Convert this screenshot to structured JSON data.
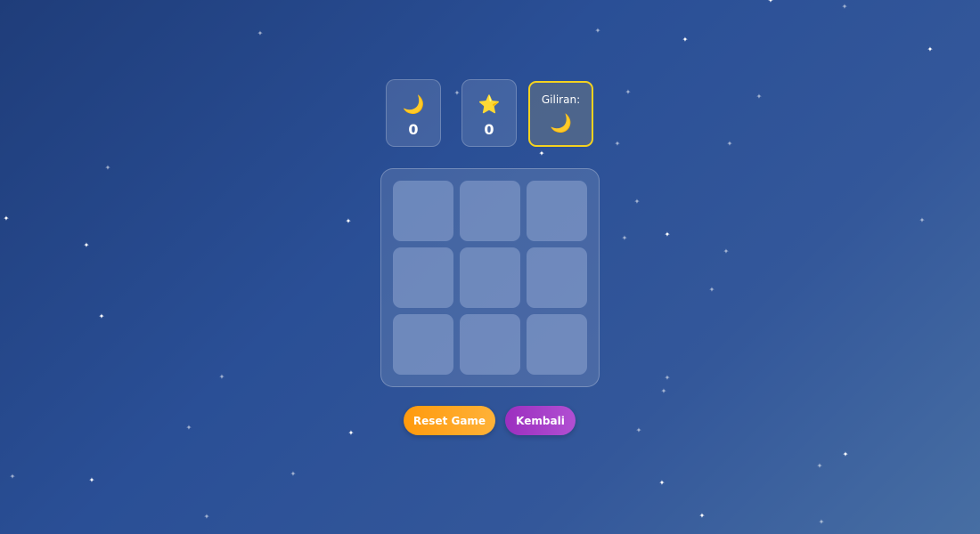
{
  "scoreboard": {
    "player_moon": {
      "icon": "🌙",
      "icon_name": "crescent-moon-icon",
      "score": "0"
    },
    "player_star": {
      "icon": "⭐",
      "icon_name": "star-icon",
      "score": "0"
    },
    "turn": {
      "label": "Giliran:",
      "icon": "🌙",
      "icon_name": "crescent-moon-icon"
    }
  },
  "board": {
    "cells": [
      "",
      "",
      "",
      "",
      "",
      "",
      "",
      "",
      ""
    ]
  },
  "buttons": {
    "reset_label": "Reset Game",
    "back_label": "Kembali"
  },
  "colors": {
    "background_start": "#1f3d7a",
    "background_end": "#476ea3",
    "turn_border": "#f4d21f",
    "reset_button": "#ff9a0d",
    "back_button": "#9c2fbf"
  }
}
